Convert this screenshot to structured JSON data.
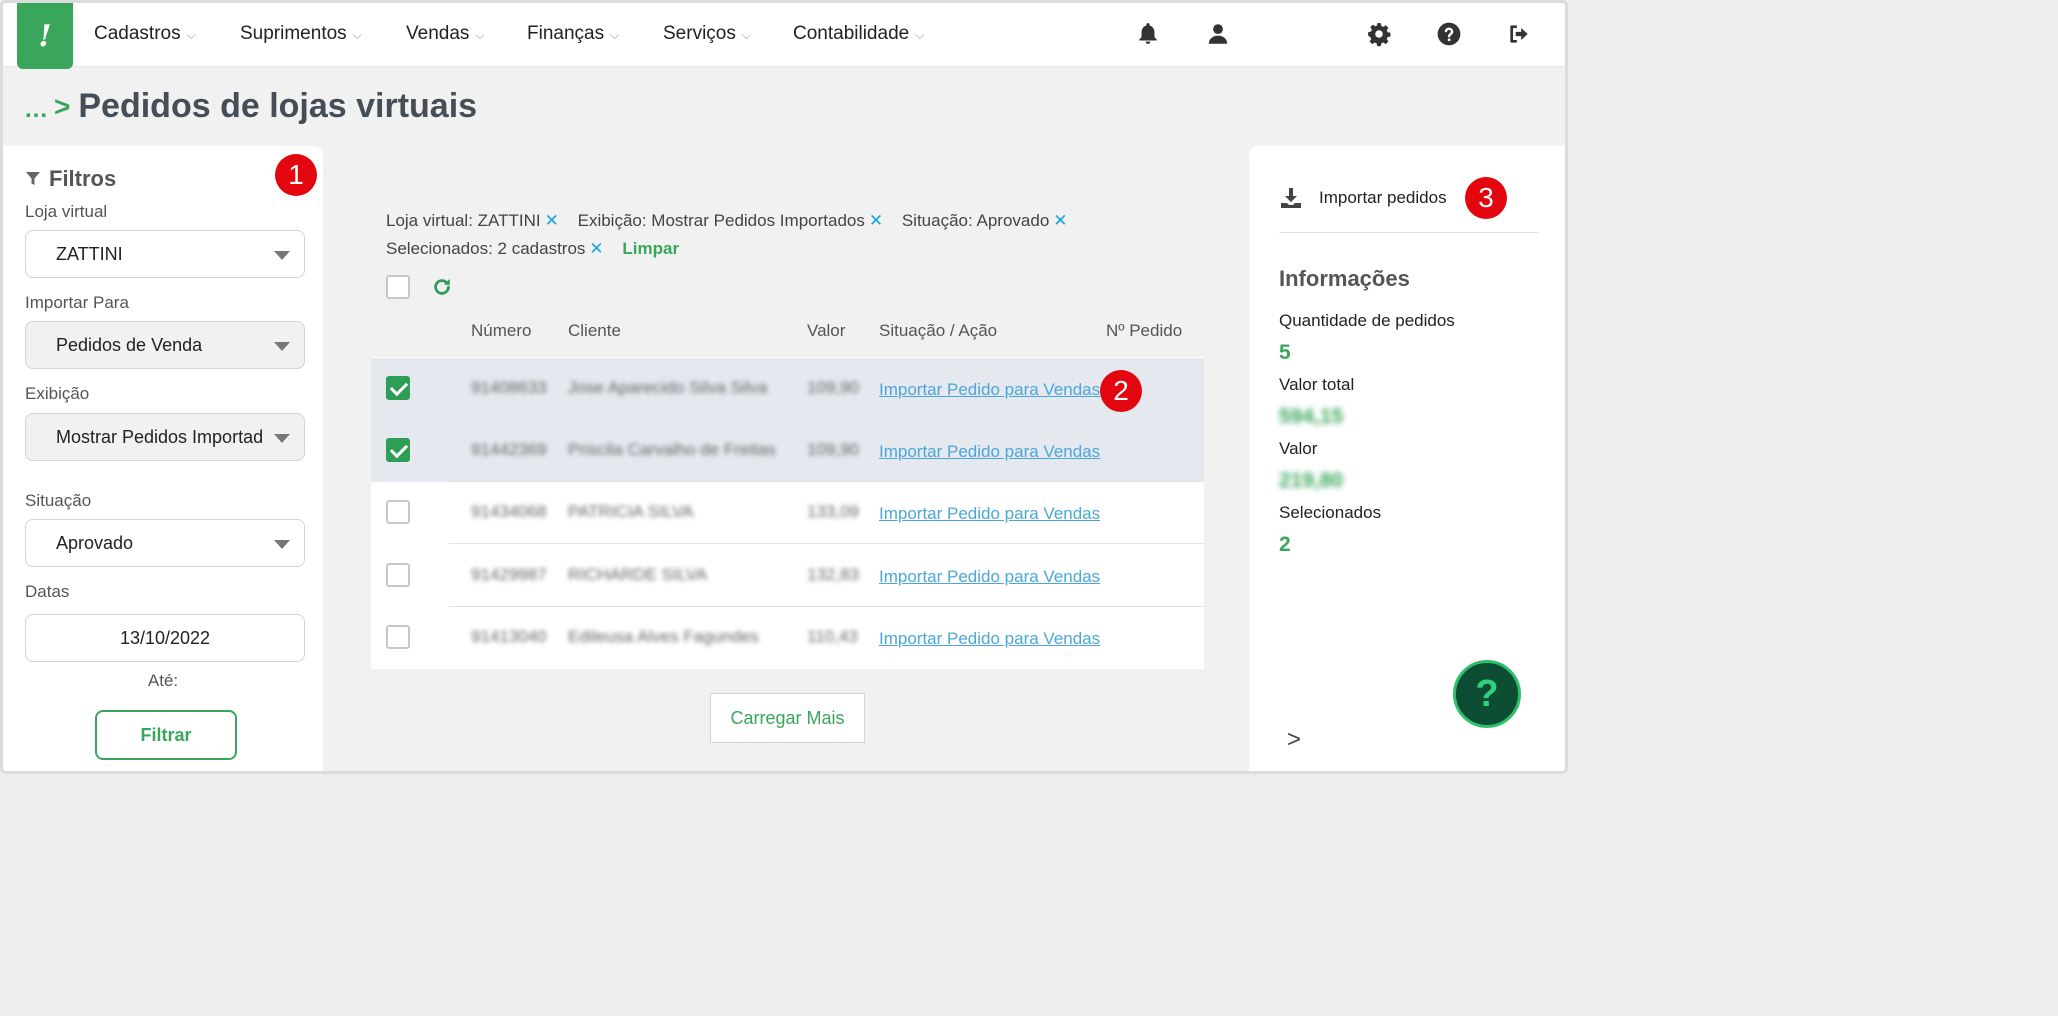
{
  "nav": {
    "items": [
      {
        "label": "Cadastros"
      },
      {
        "label": "Suprimentos"
      },
      {
        "label": "Vendas"
      },
      {
        "label": "Finanças"
      },
      {
        "label": "Serviços"
      },
      {
        "label": "Contabilidade"
      }
    ],
    "chevron": "⌵",
    "icons": [
      "bell-icon",
      "user-icon",
      "gear-icon",
      "help-circle-icon",
      "logout-icon"
    ],
    "logo_glyph": "!"
  },
  "breadcrumb": {
    "dots": "...",
    "arrow": ">",
    "title": "Pedidos de lojas virtuais"
  },
  "filters": {
    "title": "Filtros",
    "loja_label": "Loja virtual",
    "loja_value": "ZATTINI",
    "importar_label": "Importar Para",
    "importar_value": "Pedidos de Venda",
    "exibicao_label": "Exibição",
    "exibicao_value": "Mostrar Pedidos Importad",
    "situacao_label": "Situação",
    "situacao_value": "Aprovado",
    "datas_label": "Datas",
    "data_inicio": "13/10/2022",
    "ate_label": "Até:",
    "filtrar_label": "Filtrar"
  },
  "chips": [
    {
      "text": "Loja virtual: ZATTINI"
    },
    {
      "text": "Exibição: Mostrar Pedidos Importados"
    },
    {
      "text": "Situação: Aprovado"
    },
    {
      "text": "Selecionados: 2 cadastros"
    }
  ],
  "chip_remove_glyph": "✕",
  "limpar_label": "Limpar",
  "table": {
    "headers": {
      "numero": "Número",
      "cliente": "Cliente",
      "valor": "Valor",
      "situacao": "Situação / Ação",
      "pedido": "Nº Pedido"
    },
    "rows": [
      {
        "checked": true,
        "numero": "91408633",
        "cliente": "Jose Aparecido Silva Silva",
        "valor": "109,90",
        "acao": "Importar Pedido para Vendas"
      },
      {
        "checked": true,
        "numero": "91442369",
        "cliente": "Priscila Carvalho de Freitas",
        "valor": "109,90",
        "acao": "Importar Pedido para Vendas"
      },
      {
        "checked": false,
        "numero": "91434068",
        "cliente": "PATRICIA SILVA",
        "valor": "133,09",
        "acao": "Importar Pedido para Vendas"
      },
      {
        "checked": false,
        "numero": "91429987",
        "cliente": "RICHARDE SILVA",
        "valor": "132,83",
        "acao": "Importar Pedido para Vendas"
      },
      {
        "checked": false,
        "numero": "91413040",
        "cliente": "Edileusa Alves Fagundes",
        "valor": "110,43",
        "acao": "Importar Pedido para Vendas"
      }
    ]
  },
  "carregar_label": "Carregar Mais",
  "right_panel": {
    "import_label": "Importar pedidos",
    "info_title": "Informações",
    "qtd_label": "Quantidade de pedidos",
    "qtd_value": "5",
    "valor_total_label": "Valor total",
    "valor_total_value": "594,15",
    "valor_label": "Valor",
    "valor_value": "219,80",
    "selecionados_label": "Selecionados",
    "selecionados_value": "2",
    "chevron": ">"
  },
  "help_glyph": "?",
  "badges": [
    "1",
    "2",
    "3"
  ],
  "colors": {
    "brand_green": "#3aa65c",
    "link_blue": "#4aa7d8",
    "badge_red": "#e3060f",
    "chip_x_blue": "#1aa3e0"
  }
}
